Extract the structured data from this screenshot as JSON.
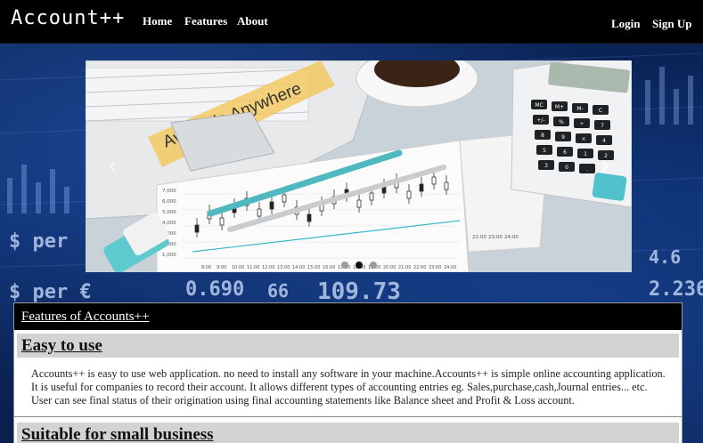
{
  "navbar": {
    "brand": "Account++",
    "links": [
      "Home",
      "Features",
      "About"
    ],
    "right_links": [
      "Login",
      "Sign Up"
    ]
  },
  "carousel": {
    "banner_text": "Available Anywhere",
    "chart_y_ticks": [
      "7,000",
      "6,000",
      "5,000",
      "4,000",
      "3,000",
      "2,000",
      "1,000"
    ],
    "chart_x_ticks": [
      "8:00",
      "9:00",
      "10:00",
      "11:00",
      "12:00",
      "13:00",
      "14:00",
      "15:00",
      "16:00",
      "17:00",
      "18:00",
      "19:00",
      "20:00",
      "21:00",
      "22:00",
      "23:00",
      "24:00"
    ],
    "calc_keys": [
      "MC",
      "M+",
      "M-",
      "C",
      "+/-",
      "%",
      "÷",
      "7",
      "8",
      "9",
      "×",
      "4",
      "5",
      "6",
      "1",
      "2",
      "3",
      "0",
      "."
    ],
    "paper_numbers": [
      "22:00",
      "23:00",
      "24:00"
    ],
    "slide_count": 3,
    "active_slide": 2
  },
  "background_numbers": [
    "$ per",
    "$ per €",
    "0.690",
    "66",
    "109.73",
    "2.236",
    "4.6"
  ],
  "features": {
    "header": "Features of Accounts++",
    "items": [
      {
        "title": "Easy to use",
        "description": "Accounts++ is easy to use web application. no need to install any software in your machine.Accounts++ is simple online accounting application. It is useful for companies to record their account. It allows different types of accounting entries eg. Sales,purchase,cash,Journal entries... etc. User can see final status of their origination using final accounting statements like Balance sheet and Profit & Loss account."
      },
      {
        "title": "Suitable for small business"
      }
    ]
  }
}
